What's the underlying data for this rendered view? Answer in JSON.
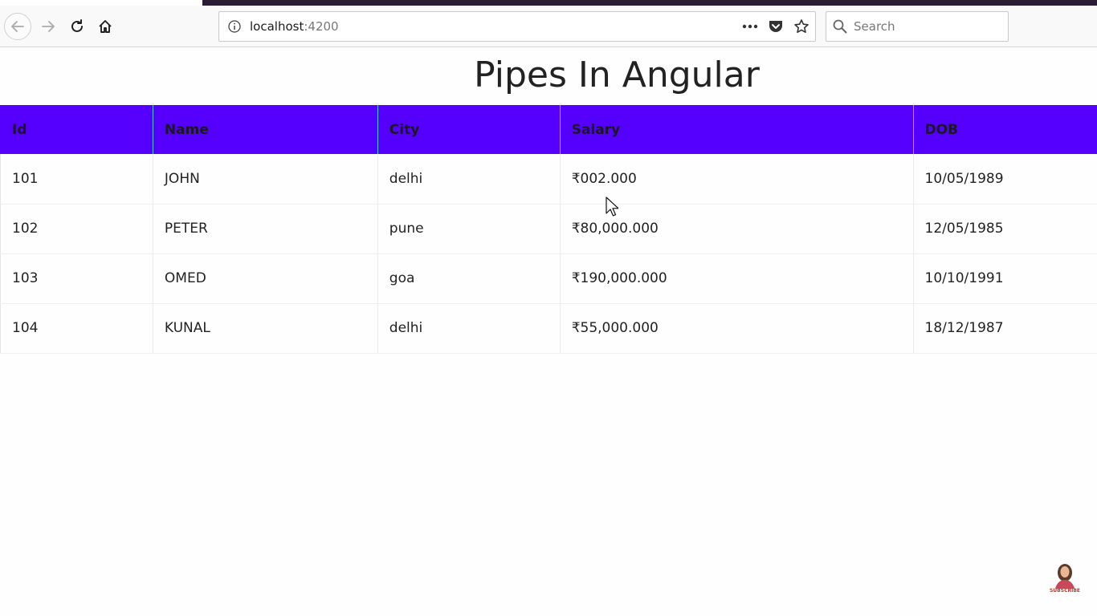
{
  "browser": {
    "url_host": "localhost",
    "url_port": ":4200",
    "search_placeholder": "Search"
  },
  "page": {
    "title": "Pipes In Angular"
  },
  "table": {
    "headers": [
      "Id",
      "Name",
      "City",
      "Salary",
      "DOB"
    ],
    "rows": [
      [
        "101",
        "JOHN",
        "delhi",
        "₹002.000",
        "10/05/1989"
      ],
      [
        "102",
        "PETER",
        "pune",
        "₹80,000.000",
        "12/05/1985"
      ],
      [
        "103",
        "OMED",
        "goa",
        "₹190,000.000",
        "10/10/1991"
      ],
      [
        "104",
        "KUNAL",
        "delhi",
        "₹55,000.000",
        "18/12/1987"
      ]
    ],
    "header_color": "#5500ff"
  },
  "overlay": {
    "subscribe_label": "SUBSCRIBE"
  }
}
